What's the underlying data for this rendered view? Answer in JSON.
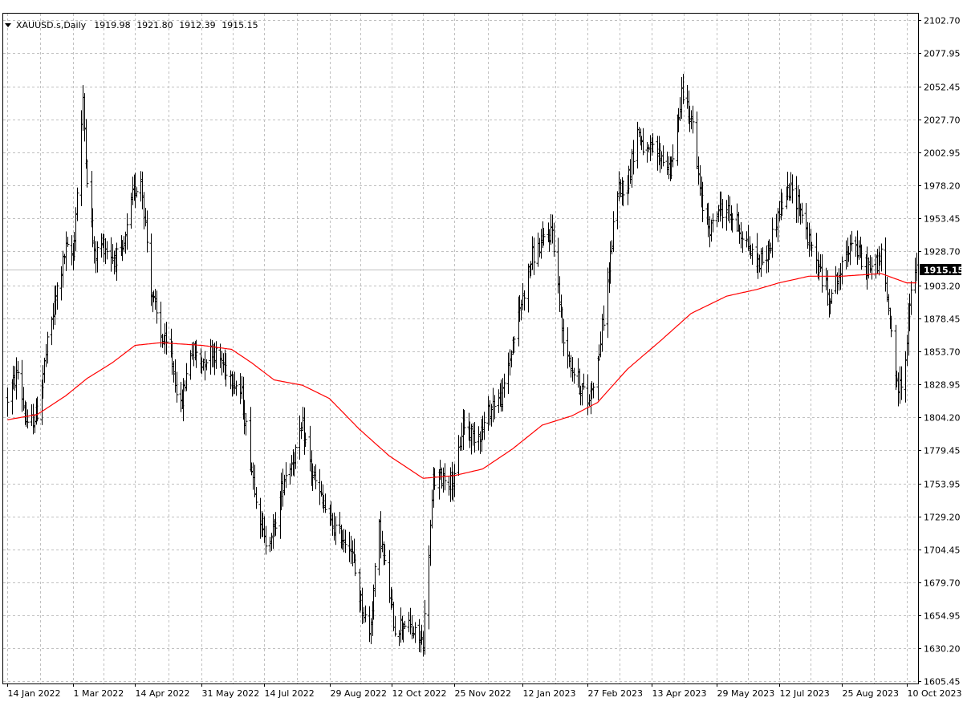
{
  "header": {
    "symbol": "XAUUSD.s,Daily",
    "open": "1919.98",
    "high": "1921.80",
    "low": "1912.39",
    "close": "1915.15"
  },
  "colors": {
    "background": "#ffffff",
    "grid": "#c0c0c0",
    "bars": "#000000",
    "moving_average": "#ff0000",
    "price_line": "#c0c0c0",
    "price_label_bg": "#000000",
    "price_label_text": "#ffffff"
  },
  "chart_data": {
    "type": "bar",
    "style": "OHLC",
    "symbol": "XAUUSD.s",
    "timeframe": "Daily",
    "ylim": [
      1605.45,
      2102.7
    ],
    "y_ticks": [
      "2102.70",
      "2077.95",
      "2052.45",
      "2027.70",
      "2002.95",
      "1978.20",
      "1953.45",
      "1928.70",
      "1903.20",
      "1878.45",
      "1853.70",
      "1828.95",
      "1804.20",
      "1779.45",
      "1753.95",
      "1729.20",
      "1704.45",
      "1679.70",
      "1654.95",
      "1630.20",
      "1605.45"
    ],
    "x_ticks": [
      "14 Jan 2022",
      "1 Mar 2022",
      "14 Apr 2022",
      "31 May 2022",
      "14 Jul 2022",
      "29 Aug 2022",
      "12 Oct 2022",
      "25 Nov 2022",
      "12 Jan 2023",
      "27 Feb 2023",
      "13 Apr 2023",
      "29 May 2023",
      "12 Jul 2023",
      "25 Aug 2023",
      "10 Oct 2023"
    ],
    "current_price": "1915.15",
    "grid": true,
    "price_keypoints": [
      [
        "14 Jan 2022",
        1818
      ],
      [
        "21 Jan 2022",
        1838
      ],
      [
        "28 Jan 2022",
        1795
      ],
      [
        "4 Feb 2022",
        1808
      ],
      [
        "11 Feb 2022",
        1858
      ],
      [
        "18 Feb 2022",
        1900
      ],
      [
        "24 Feb 2022",
        1930
      ],
      [
        "1 Mar 2022",
        1925
      ],
      [
        "8 Mar 2022",
        2040
      ],
      [
        "11 Mar 2022",
        1985
      ],
      [
        "16 Mar 2022",
        1925
      ],
      [
        "22 Mar 2022",
        1935
      ],
      [
        "29 Mar 2022",
        1925
      ],
      [
        "5 Apr 2022",
        1925
      ],
      [
        "12 Apr 2022",
        1970
      ],
      [
        "18 Apr 2022",
        1985
      ],
      [
        "25 Apr 2022",
        1900
      ],
      [
        "2 May 2022",
        1865
      ],
      [
        "9 May 2022",
        1850
      ],
      [
        "16 May 2022",
        1810
      ],
      [
        "23 May 2022",
        1855
      ],
      [
        "31 May 2022",
        1845
      ],
      [
        "7 Jun 2022",
        1855
      ],
      [
        "14 Jun 2022",
        1845
      ],
      [
        "21 Jun 2022",
        1835
      ],
      [
        "28 Jun 2022",
        1820
      ],
      [
        "5 Jul 2022",
        1765
      ],
      [
        "14 Jul 2022",
        1710
      ],
      [
        "21 Jul 2022",
        1720
      ],
      [
        "28 Jul 2022",
        1760
      ],
      [
        "4 Aug 2022",
        1775
      ],
      [
        "10 Aug 2022",
        1795
      ],
      [
        "17 Aug 2022",
        1760
      ],
      [
        "24 Aug 2022",
        1740
      ],
      [
        "29 Aug 2022",
        1725
      ],
      [
        "5 Sep 2022",
        1715
      ],
      [
        "12 Sep 2022",
        1710
      ],
      [
        "19 Sep 2022",
        1670
      ],
      [
        "26 Sep 2022",
        1640
      ],
      [
        "3 Oct 2022",
        1720
      ],
      [
        "10 Oct 2022",
        1670
      ],
      [
        "14 Oct 2022",
        1645
      ],
      [
        "21 Oct 2022",
        1650
      ],
      [
        "28 Oct 2022",
        1640
      ],
      [
        "3 Nov 2022",
        1635
      ],
      [
        "10 Nov 2022",
        1755
      ],
      [
        "17 Nov 2022",
        1760
      ],
      [
        "25 Nov 2022",
        1755
      ],
      [
        "1 Dec 2022",
        1800
      ],
      [
        "8 Dec 2022",
        1790
      ],
      [
        "15 Dec 2022",
        1795
      ],
      [
        "22 Dec 2022",
        1815
      ],
      [
        "29 Dec 2022",
        1820
      ],
      [
        "5 Jan 2023",
        1860
      ],
      [
        "12 Jan 2023",
        1895
      ],
      [
        "19 Jan 2023",
        1925
      ],
      [
        "26 Jan 2023",
        1935
      ],
      [
        "2 Feb 2023",
        1945
      ],
      [
        "9 Feb 2023",
        1870
      ],
      [
        "16 Feb 2023",
        1840
      ],
      [
        "23 Feb 2023",
        1825
      ],
      [
        "27 Feb 2023",
        1815
      ],
      [
        "6 Mar 2023",
        1845
      ],
      [
        "13 Mar 2023",
        1905
      ],
      [
        "20 Mar 2023",
        1975
      ],
      [
        "27 Mar 2023",
        1980
      ],
      [
        "3 Apr 2023",
        2020
      ],
      [
        "10 Apr 2023",
        2000
      ],
      [
        "13 Apr 2023",
        2005
      ],
      [
        "20 Apr 2023",
        2000
      ],
      [
        "27 Apr 2023",
        1990
      ],
      [
        "4 May 2023",
        2050
      ],
      [
        "11 May 2023",
        2030
      ],
      [
        "18 May 2023",
        1965
      ],
      [
        "25 May 2023",
        1945
      ],
      [
        "29 May 2023",
        1960
      ],
      [
        "5 Jun 2023",
        1960
      ],
      [
        "12 Jun 2023",
        1950
      ],
      [
        "19 Jun 2023",
        1935
      ],
      [
        "26 Jun 2023",
        1920
      ],
      [
        "3 Jul 2023",
        1925
      ],
      [
        "12 Jul 2023",
        1960
      ],
      [
        "19 Jul 2023",
        1975
      ],
      [
        "26 Jul 2023",
        1965
      ],
      [
        "2 Aug 2023",
        1935
      ],
      [
        "9 Aug 2023",
        1915
      ],
      [
        "16 Aug 2023",
        1895
      ],
      [
        "25 Aug 2023",
        1915
      ],
      [
        "1 Sep 2023",
        1940
      ],
      [
        "8 Sep 2023",
        1920
      ],
      [
        "15 Sep 2023",
        1915
      ],
      [
        "22 Sep 2023",
        1925
      ],
      [
        "29 Sep 2023",
        1870
      ],
      [
        "3 Oct 2023",
        1825
      ],
      [
        "6 Oct 2023",
        1830
      ],
      [
        "10 Oct 2023",
        1860
      ],
      [
        "13 Oct 2023",
        1900
      ],
      [
        "17 Oct 2023",
        1915
      ]
    ],
    "ma_keypoints": [
      [
        "14 Jan 2022",
        1802
      ],
      [
        "4 Feb 2022",
        1806
      ],
      [
        "24 Feb 2022",
        1820
      ],
      [
        "11 Mar 2022",
        1833
      ],
      [
        "29 Mar 2022",
        1845
      ],
      [
        "14 Apr 2022",
        1858
      ],
      [
        "2 May 2022",
        1860
      ],
      [
        "31 May 2022",
        1858
      ],
      [
        "21 Jun 2022",
        1855
      ],
      [
        "5 Jul 2022",
        1845
      ],
      [
        "21 Jul 2022",
        1832
      ],
      [
        "10 Aug 2022",
        1828
      ],
      [
        "29 Aug 2022",
        1818
      ],
      [
        "19 Sep 2022",
        1795
      ],
      [
        "10 Oct 2022",
        1775
      ],
      [
        "3 Nov 2022",
        1758
      ],
      [
        "25 Nov 2022",
        1760
      ],
      [
        "15 Dec 2022",
        1765
      ],
      [
        "5 Jan 2023",
        1780
      ],
      [
        "26 Jan 2023",
        1798
      ],
      [
        "16 Feb 2023",
        1805
      ],
      [
        "6 Mar 2023",
        1815
      ],
      [
        "27 Mar 2023",
        1840
      ],
      [
        "20 Apr 2023",
        1862
      ],
      [
        "11 May 2023",
        1882
      ],
      [
        "5 Jun 2023",
        1895
      ],
      [
        "26 Jun 2023",
        1900
      ],
      [
        "12 Jul 2023",
        1905
      ],
      [
        "2 Aug 2023",
        1910
      ],
      [
        "25 Aug 2023",
        1910
      ],
      [
        "22 Sep 2023",
        1912
      ],
      [
        "10 Oct 2023",
        1905
      ],
      [
        "17 Oct 2023",
        1905
      ]
    ]
  }
}
